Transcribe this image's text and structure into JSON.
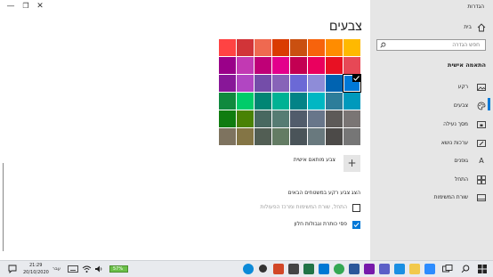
{
  "window": {
    "title": "הגדרות",
    "controls": {
      "minimize": "—",
      "maximize": "❐",
      "close": "✕"
    }
  },
  "sidebar": {
    "home_label": "בית",
    "search_placeholder": "חפש הגדרה",
    "section_title": "התאמה אישית",
    "items": [
      {
        "label": "רקע",
        "icon": "picture-icon"
      },
      {
        "label": "צבעים",
        "icon": "palette-icon",
        "selected": true
      },
      {
        "label": "מסך נעילה",
        "icon": "lock-screen-icon"
      },
      {
        "label": "ערכות נושא",
        "icon": "brush-icon"
      },
      {
        "label": "גופנים",
        "icon": "font-icon"
      },
      {
        "label": "התחל",
        "icon": "start-icon"
      },
      {
        "label": "שורת המשימות",
        "icon": "taskbar-icon"
      }
    ]
  },
  "main": {
    "heading": "צבעים",
    "swatches": [
      [
        "#ffb900",
        "#ff8c00",
        "#f7630c",
        "#ca5010",
        "#da3b01",
        "#ef6950",
        "#d13438",
        "#ff4343"
      ],
      [
        "#e74856",
        "#e81123",
        "#ea005e",
        "#c30052",
        "#e3008c",
        "#bf0077",
        "#c239b3",
        "#9a0089"
      ],
      [
        "#0078d7",
        "#0063b1",
        "#8e8cd8",
        "#6b69d6",
        "#8764b8",
        "#744da9",
        "#b146c2",
        "#881798"
      ],
      [
        "#0099bc",
        "#2d7d9a",
        "#00b7c3",
        "#038387",
        "#00b294",
        "#018574",
        "#00cc6a",
        "#10893e"
      ],
      [
        "#7a7574",
        "#5d5a58",
        "#68768a",
        "#515c6b",
        "#567c73",
        "#486860",
        "#498205",
        "#107c10"
      ],
      [
        "#767676",
        "#4c4a48",
        "#69797e",
        "#4a5459",
        "#647c64",
        "#525e54",
        "#847545",
        "#7e735f"
      ]
    ],
    "selected_swatch": "#0078d7",
    "custom_color": {
      "icon": "+",
      "label": "צבע מותאם אישית"
    },
    "accent_surfaces_title": "הצג צבע רקע במשטחים הבאים",
    "checkboxes": [
      {
        "label": "התחל, שורת המשימות ומרכז הפעולות",
        "checked": false,
        "enabled": false
      },
      {
        "label": "פסי כותרת וגבולות חלון",
        "checked": true,
        "enabled": true
      }
    ]
  },
  "taskbar": {
    "search_icon": "search-icon",
    "task_view_icon": "task-view-icon",
    "apps": [
      {
        "name": "zoom-icon",
        "color": "#2d8cff"
      },
      {
        "name": "folder-icon",
        "color": "#f2c94c"
      },
      {
        "name": "phone-icon",
        "color": "#1a8fe3"
      },
      {
        "name": "teams-icon",
        "color": "#5b5fc7"
      },
      {
        "name": "onenote-icon",
        "color": "#7719aa"
      },
      {
        "name": "word-icon",
        "color": "#2b579a"
      },
      {
        "name": "chrome-icon",
        "color": "#34a853"
      },
      {
        "name": "outlook-icon",
        "color": "#0078d4"
      },
      {
        "name": "excel-icon",
        "color": "#217346"
      },
      {
        "name": "app-icon",
        "color": "#444"
      },
      {
        "name": "powerpoint-icon",
        "color": "#d24726"
      },
      {
        "name": "settings-icon",
        "color": "#333"
      },
      {
        "name": "edge-icon",
        "color": "#0c8ad8"
      }
    ],
    "battery": "57%",
    "language": "עבר",
    "time": "21:29",
    "date": "20/10/2020",
    "notification_icon": "notification-icon"
  }
}
